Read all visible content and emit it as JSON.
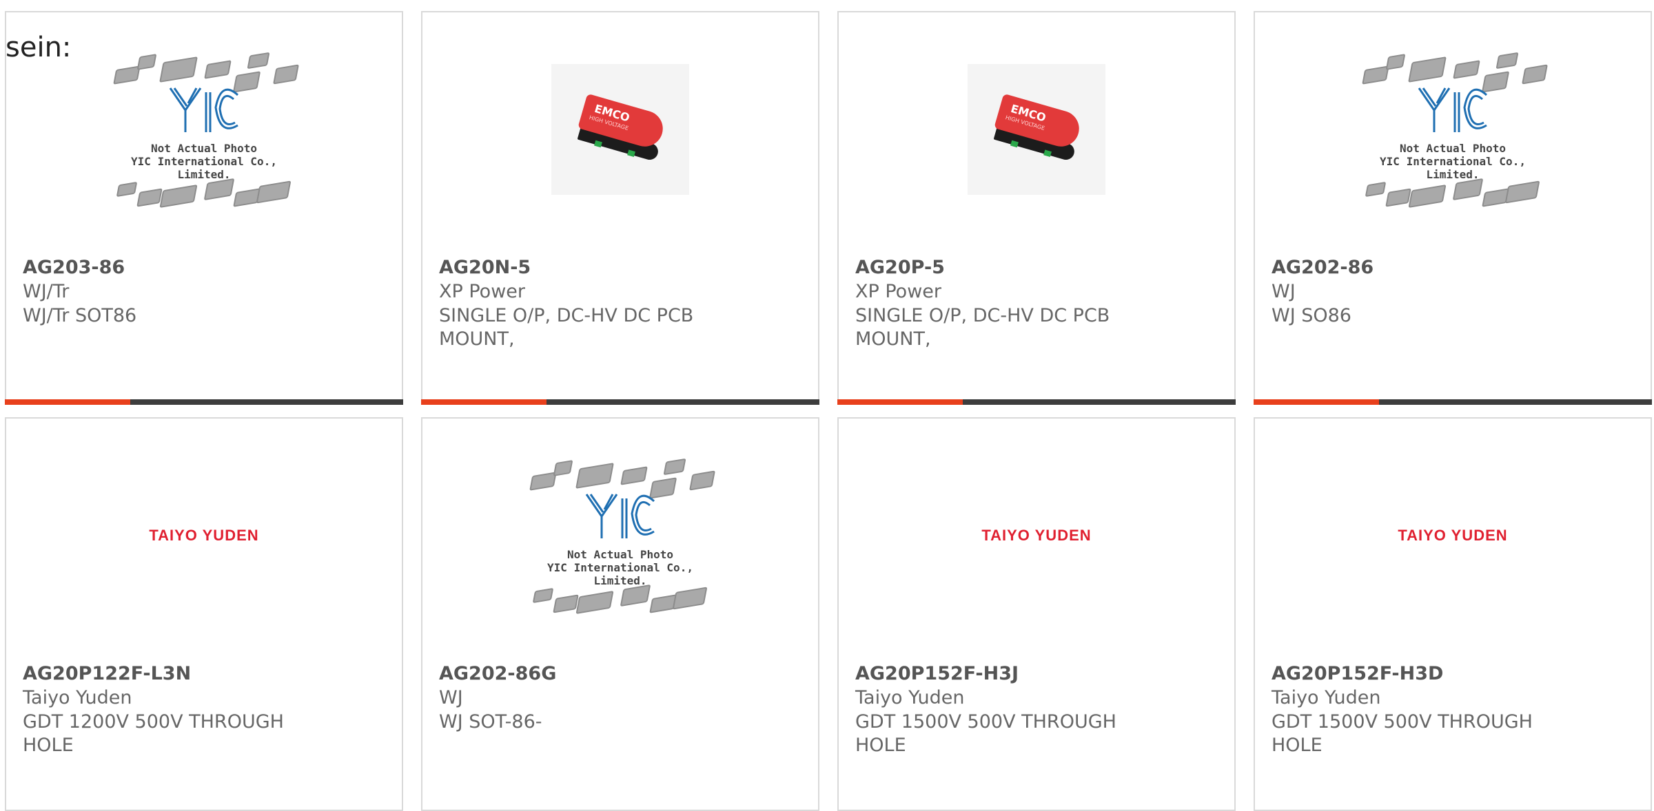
{
  "intro_text": "sein:",
  "colors": {
    "accent": "#e8401c",
    "bar": "#3d3d3d",
    "taiyo_red": "#e02030",
    "emco_red": "#e23a3a"
  },
  "placeholder": {
    "line1": "Not Actual Photo",
    "line2": "YIC International Co., Limited."
  },
  "emco": {
    "brand": "EMCO",
    "sub": "HIGH VOLTAGE"
  },
  "taiyo_logo": "TAIYO YUDEN",
  "products": [
    {
      "part": "AG203-86",
      "maker": "WJ/Tr",
      "desc": "WJ/Tr SOT86",
      "image": "yic-placeholder"
    },
    {
      "part": "AG20N-5",
      "maker": "XP Power",
      "desc": "SINGLE O/P, DC-HV DC PCB MOUNT,",
      "image": "emco-module"
    },
    {
      "part": "AG20P-5",
      "maker": "XP Power",
      "desc": "SINGLE O/P, DC-HV DC PCB MOUNT,",
      "image": "emco-module"
    },
    {
      "part": "AG202-86",
      "maker": "WJ",
      "desc": "WJ SO86",
      "image": "yic-placeholder"
    },
    {
      "part": "AG20P122F-L3N",
      "maker": "Taiyo Yuden",
      "desc": "GDT 1200V 500V THROUGH HOLE",
      "image": "taiyo-logo"
    },
    {
      "part": "AG202-86G",
      "maker": "WJ",
      "desc": "WJ SOT-86-",
      "image": "yic-placeholder"
    },
    {
      "part": "AG20P152F-H3J",
      "maker": "Taiyo Yuden",
      "desc": "GDT 1500V 500V THROUGH HOLE",
      "image": "taiyo-logo"
    },
    {
      "part": "AG20P152F-H3D",
      "maker": "Taiyo Yuden",
      "desc": "GDT 1500V 500V THROUGH HOLE",
      "image": "taiyo-logo"
    }
  ]
}
